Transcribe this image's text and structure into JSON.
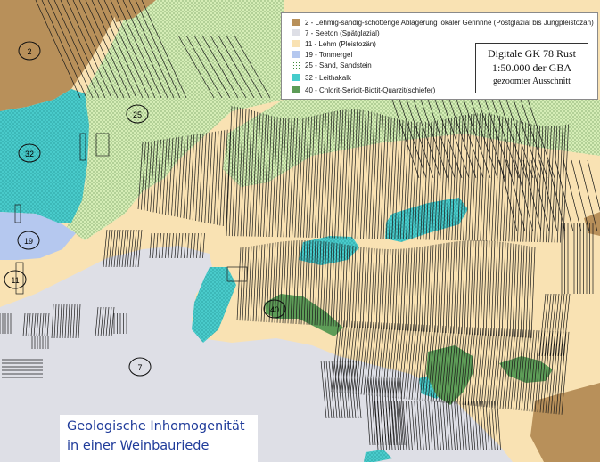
{
  "legend": {
    "items": [
      {
        "code": "2",
        "label": "2 - Lehmig-sandig-schotterige Ablagerung lokaler Gerinnne (Postglazial bis Jungpleistozän)",
        "color": "#b8905a",
        "icon": "swatch-brown"
      },
      {
        "code": "7",
        "label": "7 - Seeton (Spätglazial)",
        "color": "#dedfe6",
        "icon": "swatch-grey"
      },
      {
        "code": "11",
        "label": "11 - Lehm (Pleistozän)",
        "color": "#f9e2b3",
        "icon": "swatch-beige"
      },
      {
        "code": "19",
        "label": "19 - Tonmergel",
        "color": "#b5c8ef",
        "icon": "swatch-blue"
      },
      {
        "code": "25",
        "label": "25 - Sand, Sandstein",
        "color": "#d3ecb4",
        "icon": "swatch-green-dotted"
      },
      {
        "code": "32",
        "label": "32 - Leithakalk",
        "color": "#46cccb",
        "icon": "swatch-cyan"
      },
      {
        "code": "40",
        "label": "40 - Chlorit-Sericit-Biotit-Quarzit(schiefer)",
        "color": "#5d9c57",
        "icon": "swatch-dark-green"
      }
    ]
  },
  "map_info": {
    "line1": "Digitale GK 78 Rust",
    "line2": "1:50.000 der GBA",
    "line3": "gezoomter Ausschnitt"
  },
  "unit_labels": [
    "2",
    "25",
    "32",
    "19",
    "11",
    "40",
    "7"
  ],
  "caption": {
    "line1": "Geologische Inhomogenität",
    "line2": "in einer Weinbauriede"
  }
}
